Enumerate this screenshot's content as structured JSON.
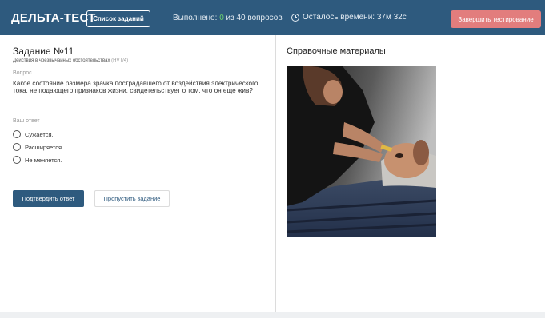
{
  "header": {
    "brand": "ДЕЛЬТА-ТЕСТ",
    "task_list_button": "Список заданий",
    "progress_prefix": "Выполнено:",
    "progress_done": "0",
    "progress_suffix": "из 40 вопросов",
    "timer_text": "Осталось времени: 37м 32с",
    "finish_button": "Завершить тестирование"
  },
  "task": {
    "title": "Задание №11",
    "category": "Действия в чрезвычайных обстоятельствах",
    "category_code": "(HVT/4)",
    "question_label": "Вопрос",
    "question_text": "Какое состояние размера зрачка пострадавшего от воздействия электрического тока, не подающего признаков жизни, свидетельствует о том, что он еще жив?",
    "answer_label": "Ваш ответ",
    "options": [
      "Сужается.",
      "Расширяется.",
      "Не меняется."
    ],
    "confirm_button": "Подтвердить ответ",
    "skip_button": "Пропустить задание"
  },
  "reference": {
    "title": "Справочные материалы"
  },
  "icons": {
    "timer": "clock-icon",
    "option": "radio-button"
  },
  "colors": {
    "header_bg": "#2e5a7e",
    "progress_done": "#6cd36c",
    "finish_button": "#e27d7d",
    "primary_button": "#2e5a7e"
  }
}
